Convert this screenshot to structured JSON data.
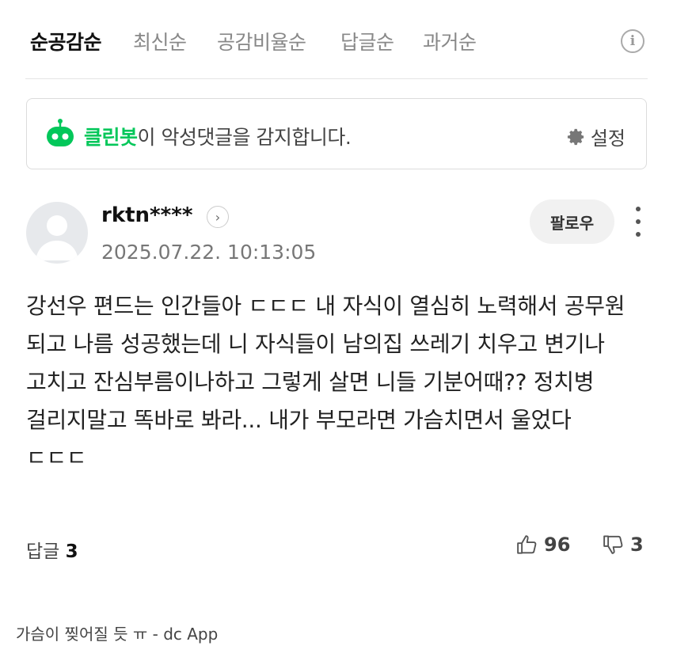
{
  "sort_tabs": [
    {
      "label": "순공감순",
      "active": true
    },
    {
      "label": "최신순",
      "active": false
    },
    {
      "label": "공감비율순",
      "active": false
    },
    {
      "label": "답글순",
      "active": false
    },
    {
      "label": "과거순",
      "active": false
    }
  ],
  "info_icon_glyph": "i",
  "cleanbot": {
    "brand": "클린봇",
    "message": "이 악성댓글을 감지합니다.",
    "settings_label": "설정",
    "brand_color": "#03c75a"
  },
  "comment": {
    "author": "rktn****",
    "author_arrow": "›",
    "timestamp": "2025.07.22. 10:13:05",
    "follow_label": "팔로우",
    "body": "강선우 편드는 인간들아 ㄷㄷㄷ 내 자식이 열심히 노력해서 공무원 되고 나름 성공했는데 니 자식들이 남의집 쓰레기 치우고 변기나 고치고 잔심부름이나하고 그렇게 살면 니들 기분어때?? 정치병 걸리지말고 똑바로 봐라... 내가 부모라면 가슴치면서 울었다 ㄷㄷㄷ",
    "reply_label": "답글",
    "reply_count": "3",
    "likes": "96",
    "dislikes": "3"
  },
  "footer_text": "가슴이 찢어질 듯 ㅠ - dc App"
}
